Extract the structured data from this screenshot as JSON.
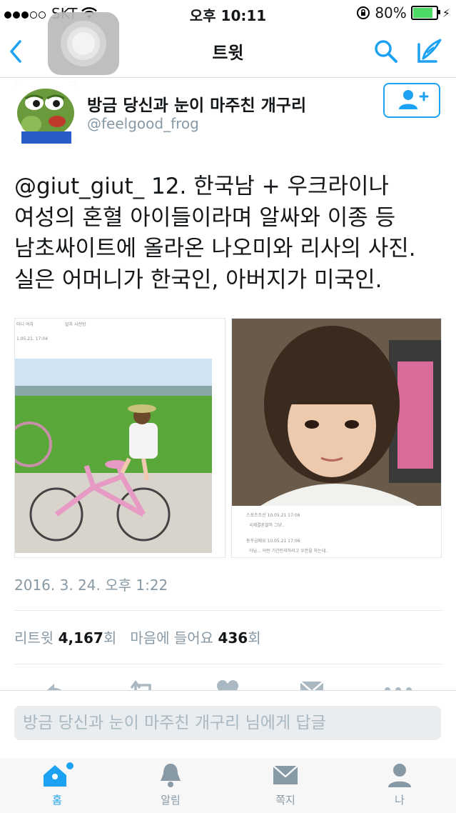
{
  "status_bar": {
    "carrier": "SKT",
    "time": "오후 10:11",
    "battery": "80%"
  },
  "nav": {
    "title": "트윗",
    "icons": [
      "back-chevron-icon",
      "search-icon",
      "compose-icon"
    ]
  },
  "tweet": {
    "author_name": "방금 당신과 눈이 마주친 개구리",
    "author_handle": "@feelgood_frog",
    "text": "@giut_giut_ 12. 한국남 + 우크라이나 여성의 혼혈 아이들이라며 알싸와 이종 등 남초싸이트에 올라온 나오미와 리사의 사진. 실은 어머니가 한국인, 아버지가 미국인.",
    "media": [
      {
        "kind": "photo-girl-bicycle",
        "caption_lines": [
          "미니 여자",
          "알자 사전방",
          "1.05.21. 17:04"
        ]
      },
      {
        "kind": "photo-girl-portrait",
        "caption_lines": [
          "스포츠조선  10.05.21 17:06",
          "국제결혼말하 그냥..",
          "동꾸금메요  10.05.21 17:06",
          "아님... 어떤 기간안지하라고 우한을 하는데.."
        ]
      }
    ],
    "timestamp": "2016. 3. 24. 오후 1:22",
    "retweet_label": "리트윗",
    "retweet_count": "4,167",
    "retweet_unit": "회",
    "like_label": "마음에 들어요",
    "like_count": "436",
    "like_unit": "회"
  },
  "reply": {
    "placeholder": "방금 당신과 눈이 마주친 개구리 님에게 답글"
  },
  "tabbar": {
    "tabs": [
      {
        "label": "홈",
        "icon": "home-icon",
        "active": true
      },
      {
        "label": "알림",
        "icon": "bell-icon",
        "active": false
      },
      {
        "label": "쪽지",
        "icon": "envelope-icon",
        "active": false
      },
      {
        "label": "나",
        "icon": "person-icon",
        "active": false
      }
    ]
  },
  "colors": {
    "accent": "#1da1f2",
    "muted": "#8899a6",
    "text": "#14171a"
  }
}
